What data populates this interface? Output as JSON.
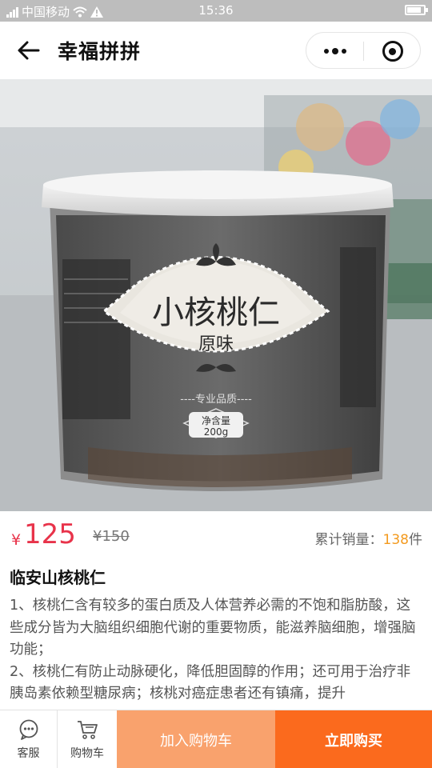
{
  "status_bar": {
    "carrier": "中国移动",
    "time": "15:36"
  },
  "nav": {
    "title": "幸福拼拼",
    "back_icon": "arrow-left-icon",
    "more_icon": "more-dots-icon",
    "close_icon": "target-circle-icon"
  },
  "carousel": {
    "image_count": 2,
    "active_index": 0,
    "active_dot_color": "#222222",
    "inactive_dot_color": "#9e9e9e",
    "label_main": "小核桃仁",
    "label_flavor": "原味",
    "label_tagline": "----专业品质----",
    "label_net_title": "净含量",
    "label_net_value": "200g"
  },
  "price": {
    "currency": "¥",
    "value": "125",
    "original": "¥150",
    "sales_label": "累计销量：",
    "sales_count": "138",
    "sales_unit": "件",
    "price_color": "#e8334a",
    "sales_count_color": "#f39a1e"
  },
  "product": {
    "title": "临安山核桃仁",
    "description": [
      "1、核桃仁含有较多的蛋白质及人体营养必需的不饱和脂肪酸，这些成分皆为大脑组织细胞代谢的重要物质，能滋养脑细胞，增强脑功能；",
      "2、核桃仁有防止动脉硬化，降低胆固醇的作用；还可用于治疗非胰岛素依赖型糖尿病；核桃对癌症患者还有镇痛，提升"
    ]
  },
  "bottom_bar": {
    "service_label": "客服",
    "service_icon": "chat-bubble-icon",
    "cart_label": "购物车",
    "cart_icon": "shopping-cart-icon",
    "add_to_cart_label": "加入购物车",
    "buy_now_label": "立即购买",
    "add_to_cart_color": "#f9a26d",
    "buy_now_color": "#fb6a1d"
  }
}
